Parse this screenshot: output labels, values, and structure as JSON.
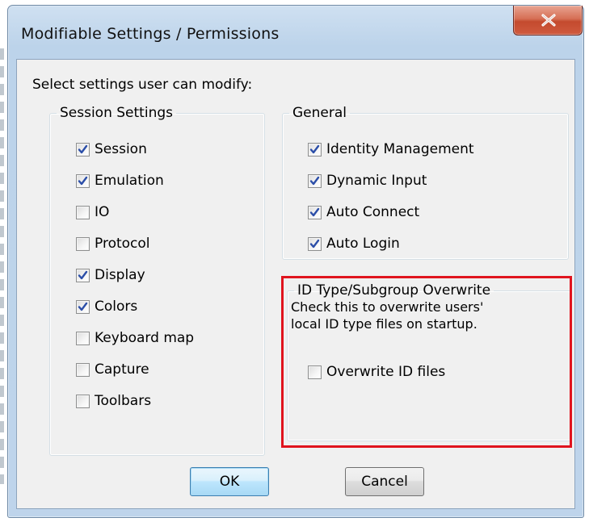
{
  "window": {
    "title": "Modifiable Settings / Permissions",
    "close_glyph": "x-icon"
  },
  "prompt": "Select settings user can modify:",
  "session_settings": {
    "legend": "Session Settings",
    "items": [
      {
        "label": "Session",
        "checked": true
      },
      {
        "label": "Emulation",
        "checked": true
      },
      {
        "label": "IO",
        "checked": false
      },
      {
        "label": "Protocol",
        "checked": false
      },
      {
        "label": "Display",
        "checked": true
      },
      {
        "label": "Colors",
        "checked": true
      },
      {
        "label": "Keyboard map",
        "checked": false
      },
      {
        "label": "Capture",
        "checked": false
      },
      {
        "label": "Toolbars",
        "checked": false
      }
    ]
  },
  "general": {
    "legend": "General",
    "items": [
      {
        "label": "Identity Management",
        "checked": true
      },
      {
        "label": "Dynamic Input",
        "checked": true
      },
      {
        "label": "Auto Connect",
        "checked": true
      },
      {
        "label": "Auto Login",
        "checked": true
      }
    ]
  },
  "overwrite": {
    "legend": "ID Type/Subgroup Overwrite",
    "description_line1": "Check this to overwrite users'",
    "description_line2": "local ID type files on startup.",
    "item": {
      "label": "Overwrite ID files",
      "checked": false
    }
  },
  "buttons": {
    "ok": "OK",
    "cancel": "Cancel"
  },
  "colors": {
    "highlight_frame": "#e0141e",
    "check_mark": "#2b4ea8",
    "close_button": "#c9543a"
  }
}
